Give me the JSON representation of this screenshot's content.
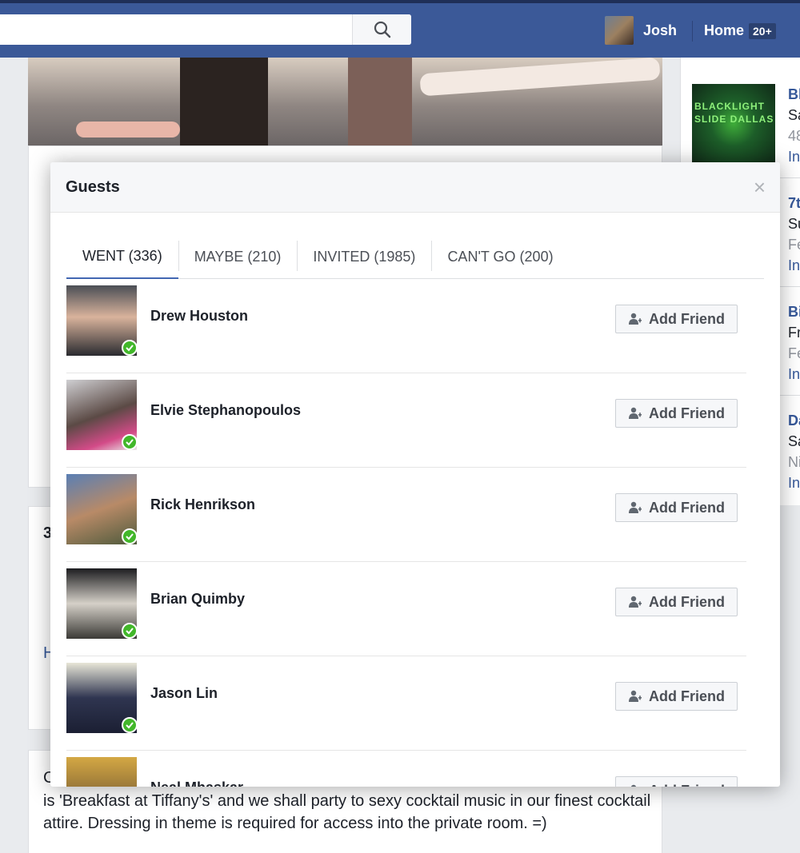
{
  "topbar": {
    "user_name": "Josh",
    "home_label": "Home",
    "notif_count": "20+"
  },
  "background": {
    "description_text": "is 'Breakfast at Tiffany's' and we shall party to sexy cocktail music in our finest cocktail attire. Dressing in theme is required for access into the private room. =)",
    "fragment_c": "C",
    "fragment_3": "3",
    "fragment_h": "H"
  },
  "right_column": {
    "ad_image_text": "BLACKLIGHT SLIDE DALLAS",
    "items": [
      {
        "title": "Bl",
        "line1": "Sa",
        "line2": "48",
        "link": "In"
      },
      {
        "title": "7t",
        "line1": "Su",
        "line2": "Fe",
        "link": "In"
      },
      {
        "title": "Bi",
        "line1": "Fr",
        "line2": "Fe",
        "link": "In"
      },
      {
        "title": "Da",
        "line1": "Sa",
        "line2": "Ni",
        "link": "In"
      }
    ]
  },
  "modal": {
    "title": "Guests",
    "close_label": "×",
    "tabs": [
      {
        "label": "WENT (336)",
        "active": true
      },
      {
        "label": "MAYBE (210)",
        "active": false
      },
      {
        "label": "INVITED (1985)",
        "active": false
      },
      {
        "label": "CAN'T GO (200)",
        "active": false
      }
    ],
    "add_friend_label": "Add Friend",
    "guests": [
      {
        "name": "Drew Houston"
      },
      {
        "name": "Elvie Stephanopoulos"
      },
      {
        "name": "Rick Henrikson"
      },
      {
        "name": "Brian Quimby"
      },
      {
        "name": "Jason Lin"
      },
      {
        "name": "Neal Mhaskar"
      }
    ]
  },
  "colors": {
    "brand_blue": "#3b5998",
    "link_blue": "#365899",
    "going_green": "#42b72a",
    "tab_underline": "#4267b2"
  }
}
